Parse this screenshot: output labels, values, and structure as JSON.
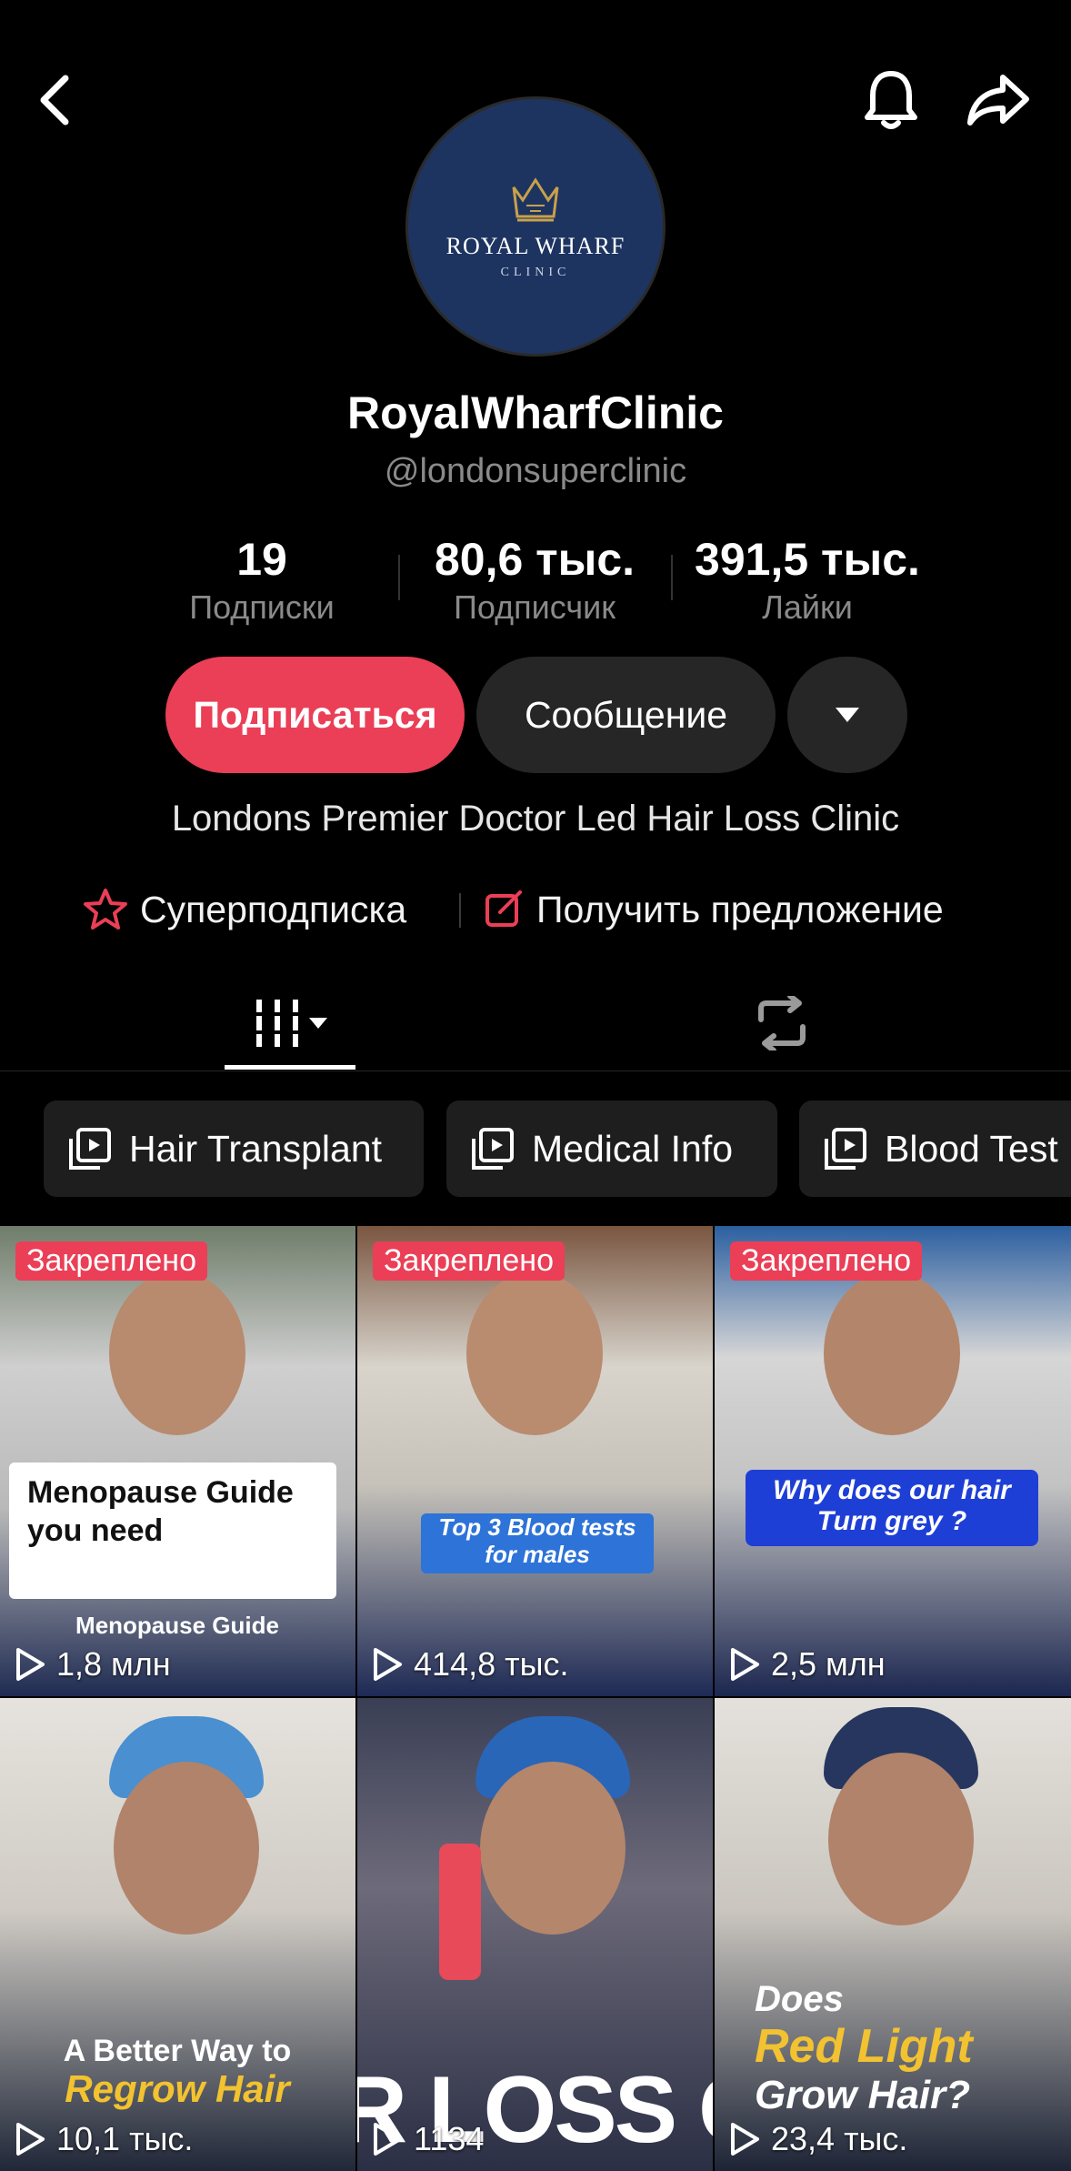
{
  "profile": {
    "display_name": "RoyalWharfClinic",
    "handle": "@londonsuperclinic",
    "avatar_brand": "ROYAL WHARF",
    "avatar_sub": "CLINIC",
    "bio": "Londons Premier Doctor Led Hair Loss Clinic"
  },
  "stats": [
    {
      "value": "19",
      "label": "Подписки"
    },
    {
      "value": "80,6 тыс.",
      "label": "Подписчик"
    },
    {
      "value": "391,5 тыс.",
      "label": "Лайки"
    }
  ],
  "actions": {
    "follow": "Подписаться",
    "message": "Сообщение"
  },
  "promos": {
    "super": "Суперподписка",
    "offer": "Получить предложение"
  },
  "chips": [
    "Hair Transplant",
    "Medical Info",
    "Blood Test"
  ],
  "videos": [
    {
      "pinned": "Закреплено",
      "views": "1,8 млн",
      "caption": "Menopause Guide you need",
      "sub_caption": "Menopause Guide"
    },
    {
      "pinned": "Закреплено",
      "views": "414,8 тыс.",
      "caption": "Top 3 Blood tests for males"
    },
    {
      "pinned": "Закреплено",
      "views": "2,5 млн",
      "caption": "Why does our hair Turn grey ?"
    },
    {
      "views": "10,1 тыс.",
      "caption_line1": "A Better Way to",
      "caption_line2": "Regrow Hair"
    },
    {
      "views": "1134",
      "caption": "R LOSS C"
    },
    {
      "views": "23,4 тыс.",
      "caption_line1": "Does",
      "caption_line2": "Red Light",
      "caption_line3": "Grow Hair?"
    }
  ],
  "colors": {
    "accent": "#ea3f56",
    "background": "#000000",
    "avatar_bg": "#1d3461",
    "gold": "#c9a14a"
  },
  "icons": {
    "back": "chevron-left-icon",
    "bell": "bell-icon",
    "share": "share-arrow-icon",
    "dropdown": "caret-down-icon",
    "grid_tab": "video-grid-icon",
    "repost_tab": "repost-icon",
    "playlist": "playlist-icon",
    "play": "play-icon"
  }
}
